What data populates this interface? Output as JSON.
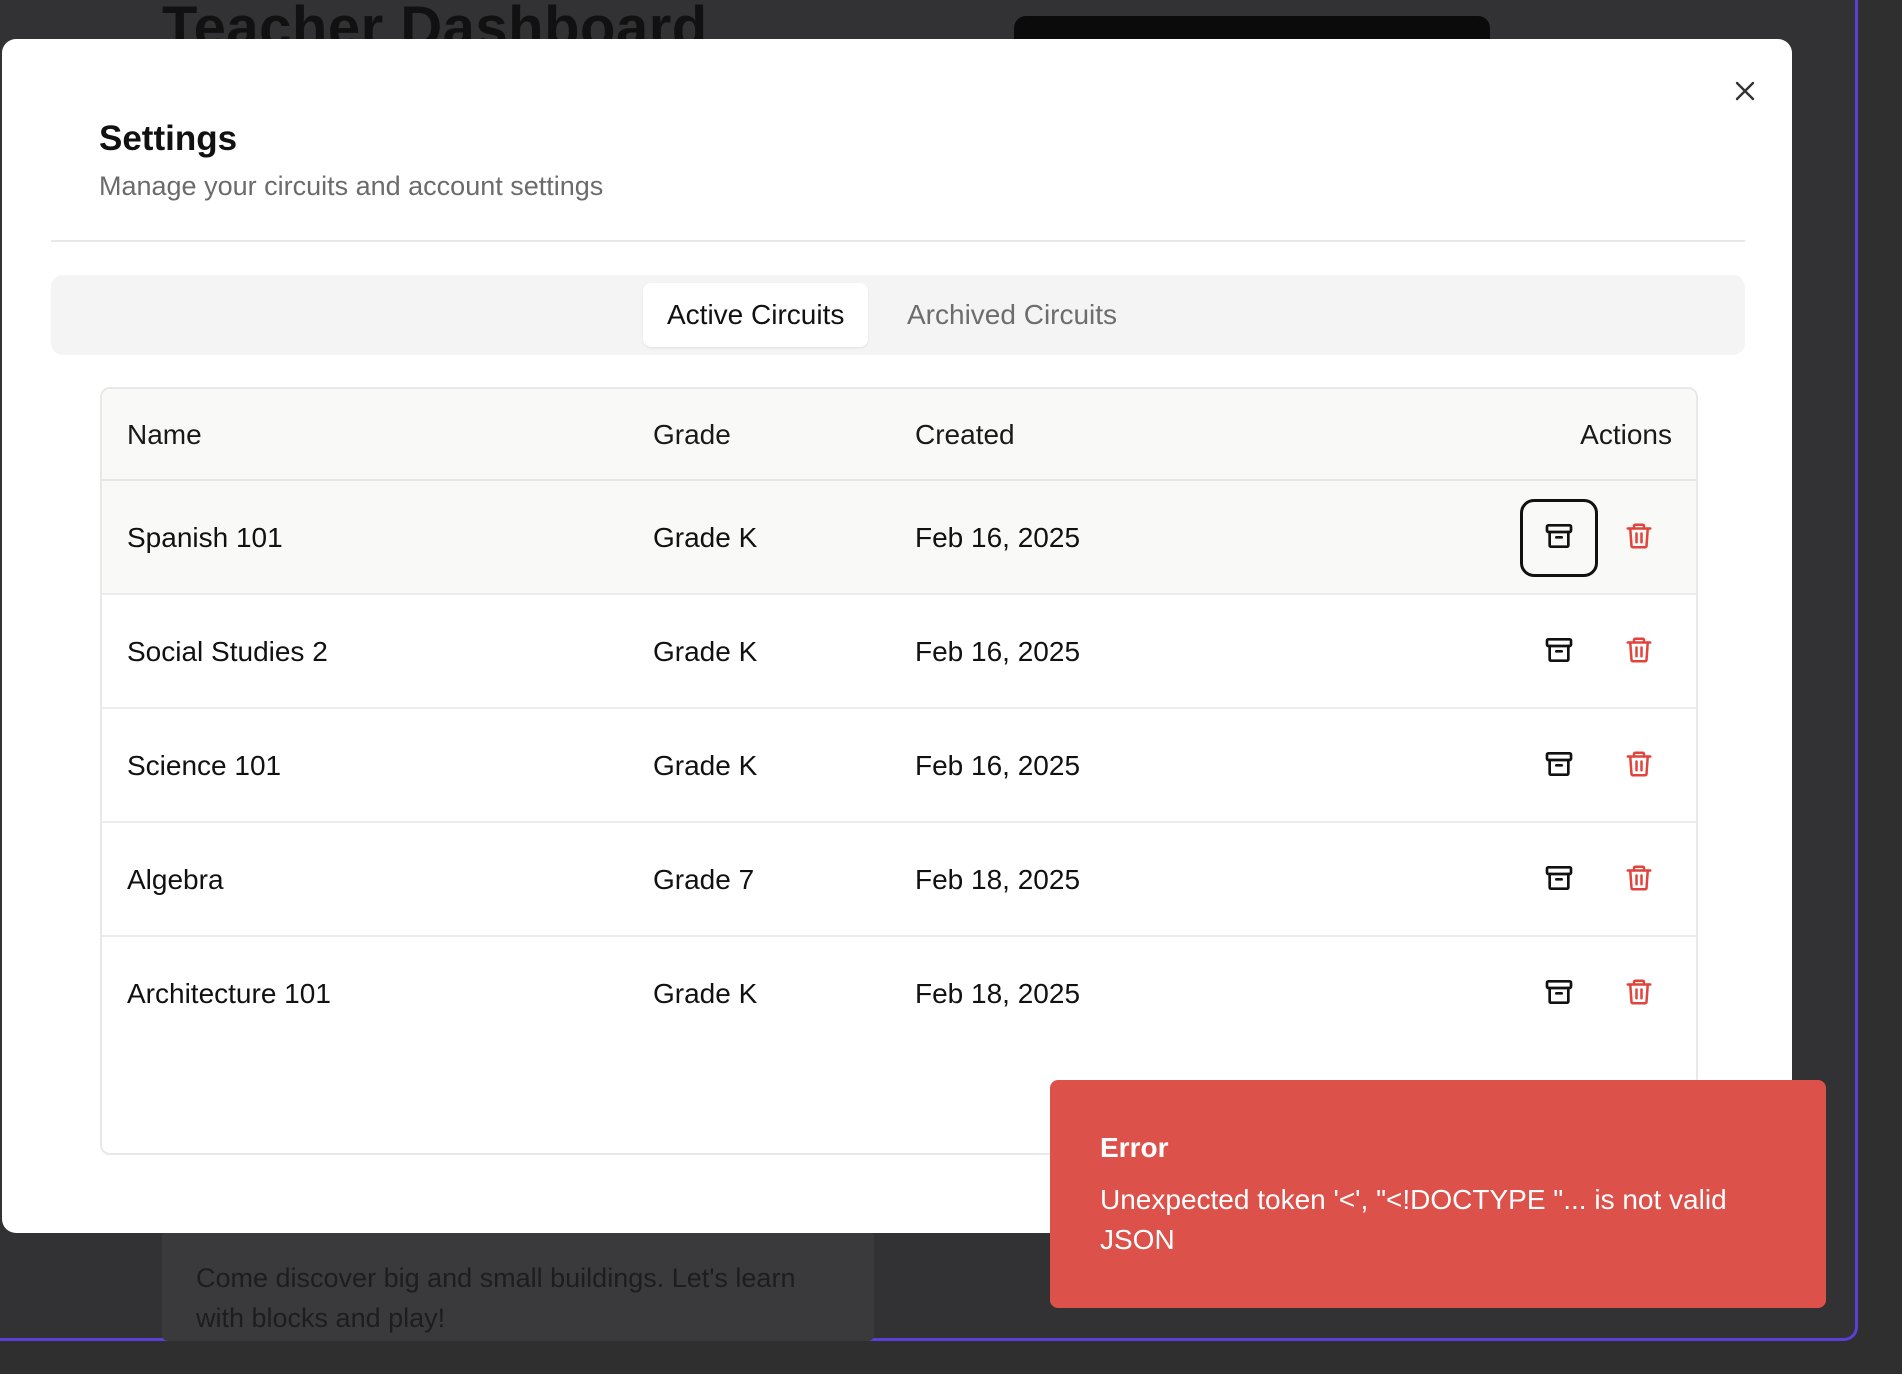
{
  "background": {
    "title": "Teacher Dashboard",
    "card_text": "Come discover big and small buildings. Let's learn with blocks and play!"
  },
  "modal": {
    "title": "Settings",
    "subtitle": "Manage your circuits and account settings",
    "tabs": [
      {
        "label": "Active Circuits",
        "active": true
      },
      {
        "label": "Archived Circuits",
        "active": false
      }
    ],
    "table": {
      "headers": {
        "name": "Name",
        "grade": "Grade",
        "created": "Created",
        "actions": "Actions"
      },
      "rows": [
        {
          "name": "Spanish 101",
          "grade": "Grade K",
          "created": "Feb 16, 2025"
        },
        {
          "name": "Social Studies 2",
          "grade": "Grade K",
          "created": "Feb 16, 2025"
        },
        {
          "name": "Science 101",
          "grade": "Grade K",
          "created": "Feb 16, 2025"
        },
        {
          "name": "Algebra",
          "grade": "Grade 7",
          "created": "Feb 18, 2025"
        },
        {
          "name": "Architecture 101",
          "grade": "Grade K",
          "created": "Feb 18, 2025"
        }
      ]
    },
    "icons": {
      "close": "close-icon",
      "archive": "archive-icon",
      "delete": "trash-icon"
    }
  },
  "toast": {
    "title": "Error",
    "message": "Unexpected token '<', \"<!DOCTYPE \"... is not valid JSON"
  },
  "colors": {
    "accent_border": "#5b3fd6",
    "error": "#dd514b",
    "delete_icon": "#e0443c"
  }
}
